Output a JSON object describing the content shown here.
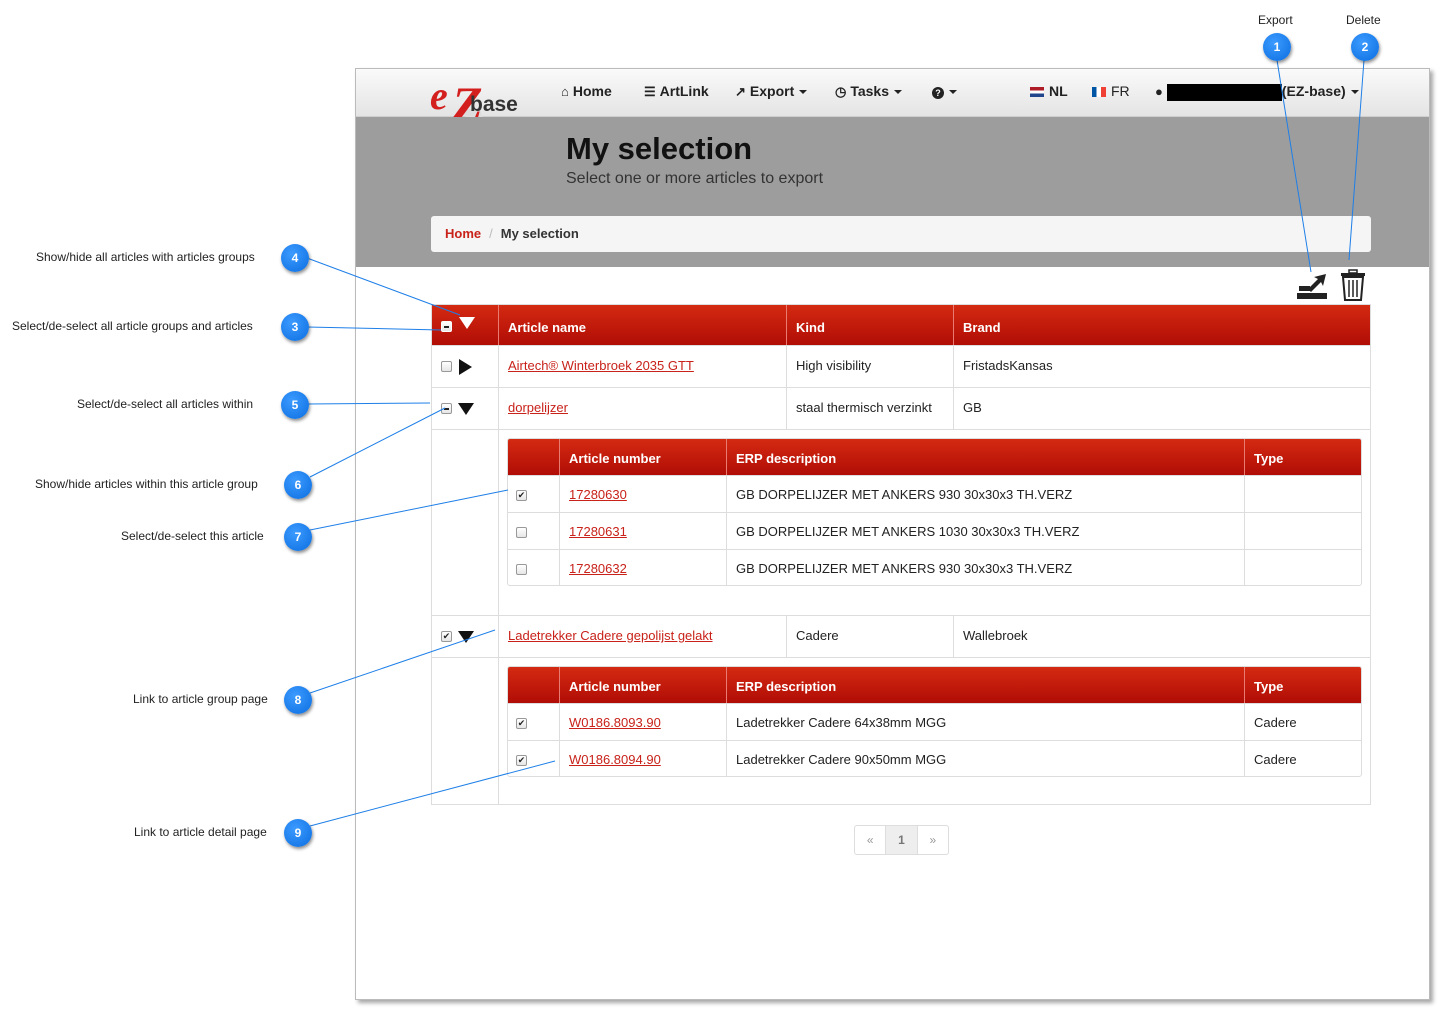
{
  "navbar": {
    "home": "Home",
    "artlink": "ArtLink",
    "export": "Export",
    "tasks": "Tasks",
    "lang_nl": "NL",
    "lang_fr": "FR",
    "user_suffix": "(EZ-base)",
    "logo_text": "base"
  },
  "hero": {
    "title": "My selection",
    "subtitle": "Select one or more articles to export"
  },
  "breadcrumb": {
    "home": "Home",
    "current": "My selection"
  },
  "table": {
    "headers": [
      "Article name",
      "Kind",
      "Brand"
    ],
    "groups": [
      {
        "name": "Airtech® Winterbroek 2035 GTT",
        "kind": "High visibility",
        "brand": "FristadsKansas"
      },
      {
        "name": "dorpelijzer",
        "kind": "staal thermisch verzinkt",
        "brand": "GB"
      },
      {
        "name": "Ladetrekker Cadere gepolijst gelakt",
        "kind": "Cadere",
        "brand": "Wallebroek"
      }
    ],
    "sub_headers": [
      "Article number",
      "ERP description",
      "Type"
    ],
    "group2_articles": [
      {
        "number": "17280630",
        "desc": "GB DORPELIJZER MET ANKERS 930 30x30x3 TH.VERZ",
        "type": ""
      },
      {
        "number": "17280631",
        "desc": "GB DORPELIJZER MET ANKERS 1030 30x30x3 TH.VERZ",
        "type": ""
      },
      {
        "number": "17280632",
        "desc": "GB DORPELIJZER MET ANKERS 930 30x30x3 TH.VERZ",
        "type": ""
      }
    ],
    "group3_articles": [
      {
        "number": "W0186.8093.90",
        "desc": "Ladetrekker Cadere 64x38mm MGG",
        "type": "Cadere"
      },
      {
        "number": "W0186.8094.90",
        "desc": "Ladetrekker Cadere 90x50mm MGG",
        "type": "Cadere"
      }
    ]
  },
  "pager": {
    "prev": "«",
    "page": "1",
    "next": "»"
  },
  "annotations": {
    "export": "Export",
    "delete": "Delete",
    "a1": "1",
    "a2": "2",
    "a3": "3",
    "a4": "4",
    "a5": "5",
    "a6": "6",
    "a7": "7",
    "a8": "8",
    "a9": "9",
    "l3": "Select/de-select all article groups and articles",
    "l4": "Show/hide all articles with articles groups",
    "l5": "Select/de-select all articles within",
    "l6": "Show/hide articles within this article group",
    "l7": "Select/de-select this article",
    "l8": "Link to article group page",
    "l9": "Link to article detail page"
  },
  "colors": {
    "accent": "#c8221a",
    "badge": "#0a6de0",
    "hero": "#9d9d9d"
  }
}
